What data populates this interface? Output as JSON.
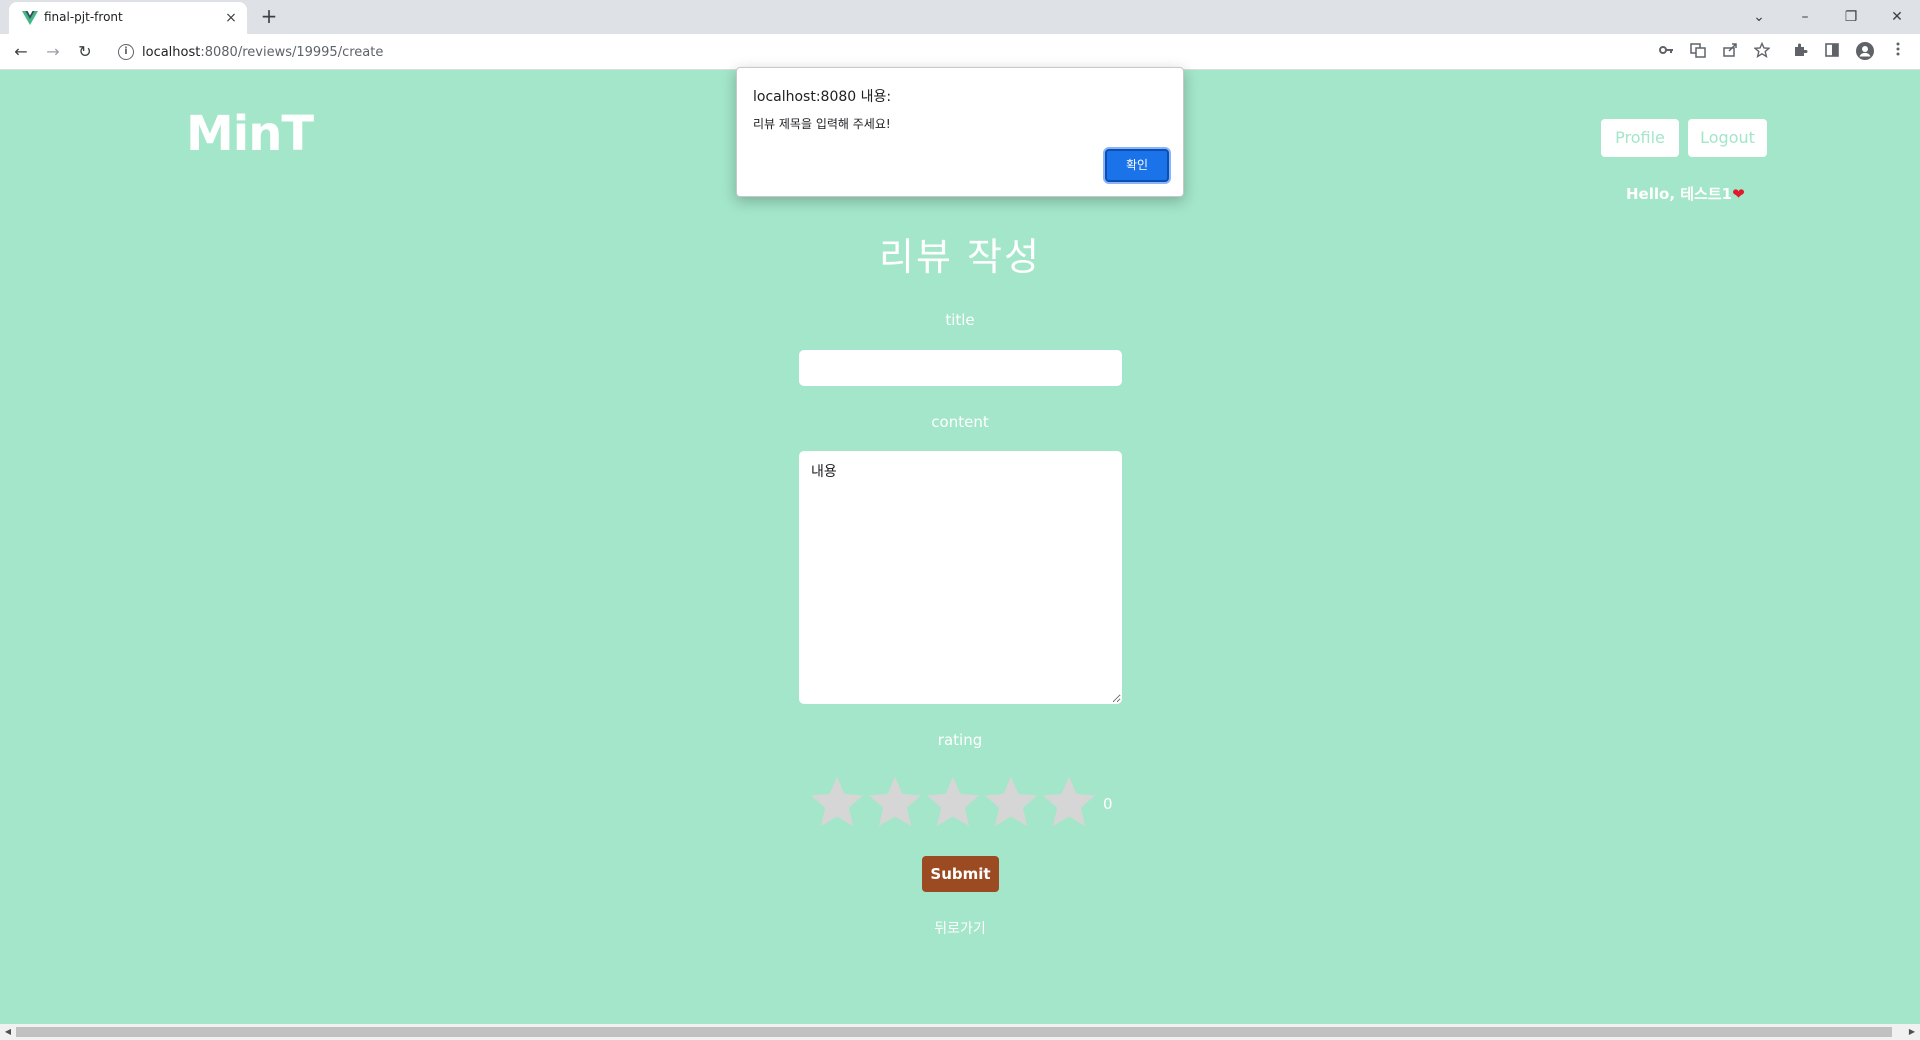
{
  "browser": {
    "tab_title": "final-pjt-front",
    "tab_close_icon": "×",
    "new_tab_icon": "+",
    "url_host": "localhost",
    "url_rest": ":8080/reviews/19995/create",
    "window_controls": {
      "chevron": "⌄",
      "minimize": "–",
      "restore": "❐",
      "close": "✕"
    },
    "nav": {
      "back": "←",
      "forward": "→",
      "reload": "↻"
    }
  },
  "header": {
    "logo": "MinT",
    "profile_button": "Profile",
    "logout_button": "Logout",
    "greeting": "Hello, 테스트1",
    "greeting_icon": "heart-icon",
    "heart_glyph": "❤"
  },
  "form": {
    "page_title": "리뷰 작성",
    "title_label": "title",
    "title_value": "",
    "content_label": "content",
    "content_value": "내용",
    "rating_label": "rating",
    "rating_value": "0",
    "rating_max": 5,
    "star_color": "#d6d6d6",
    "submit_button": "Submit",
    "back_link": "뒤로가기"
  },
  "alert": {
    "title": "localhost:8080 내용:",
    "message": "리뷰 제목을 입력해 주세요!",
    "ok_button": "확인"
  },
  "colors": {
    "page_bg": "#a3e6c9",
    "submit_bg": "#9c4a22",
    "dialog_button": "#1a73e8"
  }
}
